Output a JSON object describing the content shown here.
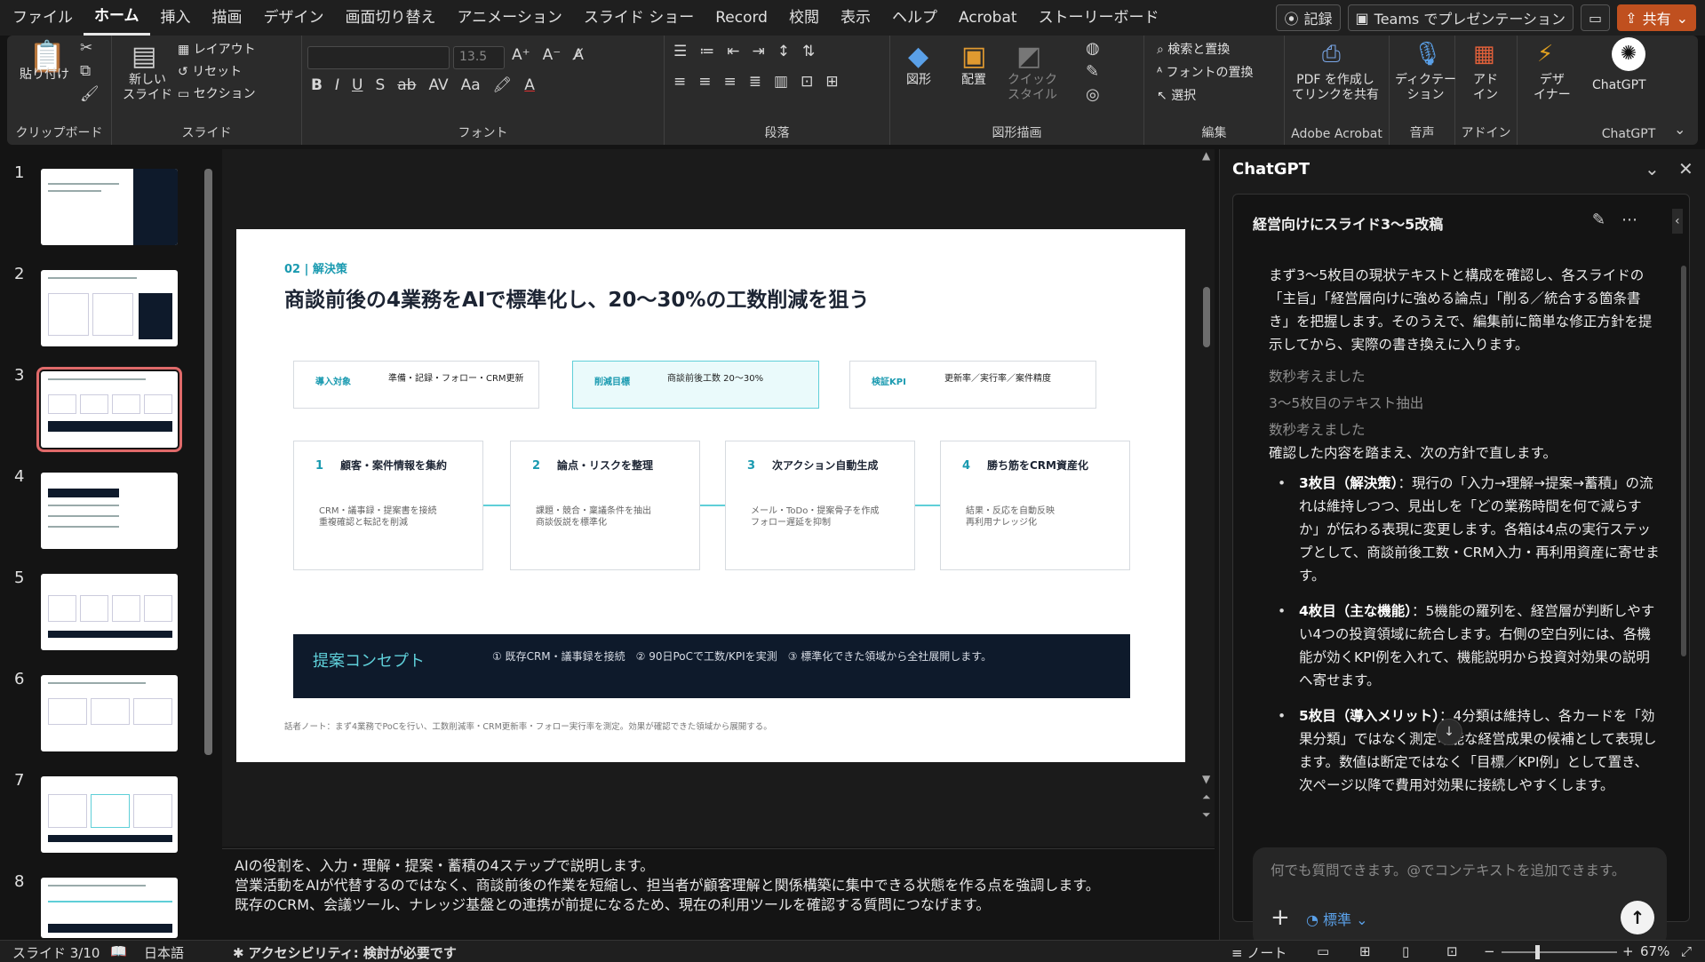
{
  "menu": {
    "items": [
      "ファイル",
      "ホーム",
      "挿入",
      "描画",
      "デザイン",
      "画面切り替え",
      "アニメーション",
      "スライド ショー",
      "Record",
      "校閲",
      "表示",
      "ヘルプ",
      "Acrobat",
      "ストーリーボード"
    ],
    "active": "ホーム",
    "record_label": "記録",
    "teams_label": "Teams でプレゼンテーション",
    "share_label": "共有"
  },
  "ribbon": {
    "clipboard": {
      "paste": "貼り付け",
      "label": "クリップボード"
    },
    "slides": {
      "new_slide": "新しい\nスライド",
      "layout": "レイアウト",
      "reset": "リセット",
      "section": "セクション",
      "label": "スライド"
    },
    "font": {
      "font_name": "",
      "font_size": "13.5",
      "label": "フォント"
    },
    "paragraph": {
      "label": "段落"
    },
    "drawing": {
      "shapes": "図形",
      "arrange": "配置",
      "quick_style": "クイック\nスタイル",
      "label": "図形描画"
    },
    "editing": {
      "find_replace": "検索と置換",
      "font_replace": "フォントの置換",
      "select": "選択",
      "label": "編集"
    },
    "acrobat": {
      "create_pdf": "PDF を作成し\nてリンクを共有",
      "label": "Adobe Acrobat"
    },
    "voice": {
      "dictation": "ディクテー\nション",
      "label": "音声"
    },
    "addin": {
      "addin": "アド\nイン",
      "label": "アドイン"
    },
    "designer": {
      "designer": "デザ\nイナー"
    },
    "chatgpt": {
      "button": "ChatGPT",
      "label": "ChatGPT"
    }
  },
  "thumbnails": {
    "numbers": [
      "1",
      "2",
      "3",
      "4",
      "5",
      "6",
      "7",
      "8"
    ],
    "selected": 3
  },
  "slide": {
    "section_label": "02 | 解決策",
    "title": "商談前後の4業務をAIで標準化し、20〜30%の工数削減を狙う",
    "kpi_boxes": [
      {
        "label": "導入対象",
        "value": "準備・記録・フォロー・CRM更新"
      },
      {
        "label": "削減目標",
        "value": "商談前後工数 20〜30%"
      },
      {
        "label": "検証KPI",
        "value": "更新率／実行率／案件精度"
      }
    ],
    "steps": [
      {
        "num": "1",
        "title": "顧客・案件情報を集約",
        "desc1": "CRM・議事録・提案書を接続",
        "desc2": "重複確認と転記を削減"
      },
      {
        "num": "2",
        "title": "論点・リスクを整理",
        "desc1": "課題・競合・稟議条件を抽出",
        "desc2": "商談仮説を標準化"
      },
      {
        "num": "3",
        "title": "次アクション自動生成",
        "desc1": "メール・ToDo・提案骨子を作成",
        "desc2": "フォロー遅延を抑制"
      },
      {
        "num": "4",
        "title": "勝ち筋をCRM資産化",
        "desc1": "結果・反応を自動反映",
        "desc2": "再利用ナレッジ化"
      }
    ],
    "concept": {
      "title": "提案コンセプト",
      "desc": "① 既存CRM・議事録を接続　② 90日PoCで工数/KPIを実測　③ 標準化できた領域から全社展開します。"
    },
    "speaker_note": "話者ノート：まず4業務でPoCを行い、工数削減率・CRM更新率・フォロー実行率を測定。効果が確認できた領域から展開する。"
  },
  "notes": {
    "line1": "AIの役割を、入力・理解・提案・蓄積の4ステップで説明します。",
    "line2": "営業活動をAIが代替するのではなく、商談前後の作業を短縮し、担当者が顧客理解と関係構築に集中できる状態を作る点を強調します。",
    "line3": "既存のCRM、会議ツール、ナレッジ基盤との連携が前提になるため、現在の利用ツールを確認する質問につなげます。"
  },
  "chat": {
    "pane_title": "ChatGPT",
    "conversation_title": "経営向けにスライド3〜5改稿",
    "intro": "まず3〜5枚目の現状テキストと構成を確認し、各スライドの「主旨」「経営層向けに強める論点」「削る／統合する箇条書き」を把握します。そのうえで、編集前に簡単な修正方針を提示してから、実際の書き換えに入ります。",
    "status1": "数秒考えました",
    "status2": "3〜5枚目のテキスト抽出",
    "status3": "数秒考えました",
    "lead": "確認した内容を踏まえ、次の方針で直します。",
    "bullets": [
      {
        "head": "3枚目（解決策）",
        "body": "：現行の「入力→理解→提案→蓄積」の流れは維持しつつ、見出しを「どの業務時間を何で減らすか」が伝わる表現に変更します。各箱は4点の実行ステップとして、商談前後工数・CRM入力・再利用資産に寄せます。"
      },
      {
        "head": "4枚目（主な機能）",
        "body": "：5機能の羅列を、経営層が判断しやすい4つの投資領域に統合します。右側の空白列には、各機能が効くKPI例を入れて、機能説明から投資対効果の説明へ寄せます。"
      },
      {
        "head": "5枚目（導入メリット）",
        "body": "：4分類は維持し、各カードを「効果分類」ではなく測定可能な経営成果の候補として表現します。数値は断定ではなく「目標／KPI例」として置き、次ページ以降で費用対効果に接続しやすくします。"
      }
    ],
    "input_placeholder": "何でも質問できます。@でコンテキストを追加できます。",
    "mode_label": "標準"
  },
  "status": {
    "slide_info": "スライド 3/10",
    "language": "日本語",
    "accessibility": "アクセシビリティ: 検討が必要です",
    "notes_label": "ノート",
    "zoom": "67%"
  }
}
